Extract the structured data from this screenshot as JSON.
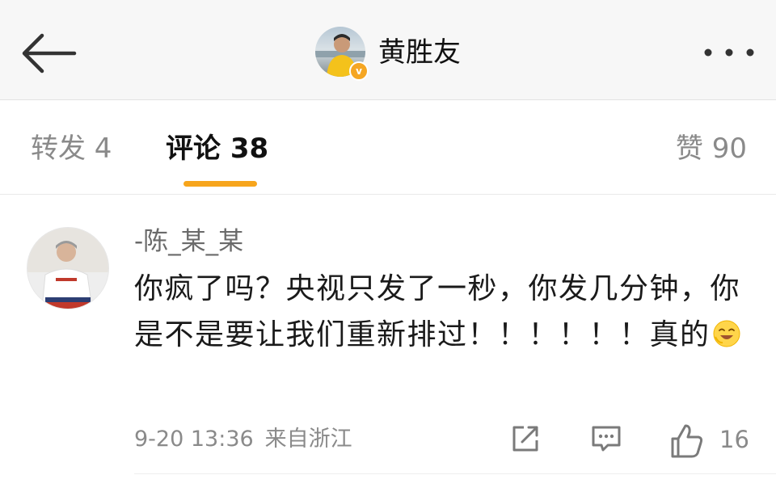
{
  "header": {
    "title": "黄胜友",
    "back_icon": "arrow-left-icon",
    "more_icon": "more-horizontal-icon",
    "verified_badge": "v",
    "badge_color": "#f5a623"
  },
  "tabs": {
    "repost": "转发 4",
    "comments": "评论 38",
    "likes": "赞 90",
    "active": "comments",
    "indicator_color": "#f7a51c"
  },
  "comment": {
    "username": "-陈_某_某",
    "text": "你疯了吗？央视只发了一秒，你发几分钟，你是不是要让我们重新排过！！！！！！真的",
    "emoji": "laughing-face-emoji",
    "time": "9-20 13:36",
    "source": "来自浙江",
    "like_count": "16",
    "action_icons": [
      "share-icon",
      "reply-icon",
      "like-icon"
    ]
  }
}
